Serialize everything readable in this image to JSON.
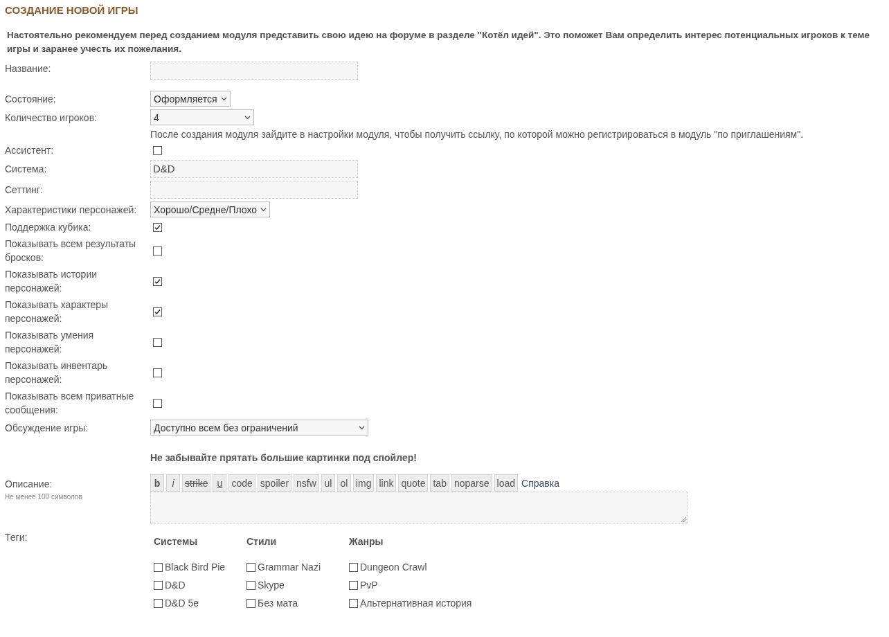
{
  "title": "СОЗДАНИЕ НОВОЙ ИГРЫ",
  "intro": "Настоятельно рекомендуем перед созданием модуля представить свою идею на форуме в разделе \"Котёл идей\". Это поможет Вам определить интерес потенциальных игроков к теме игры и заранее учесть их пожелания.",
  "fields": [
    {
      "kind": "text",
      "label": "Название:"
    },
    {
      "kind": "select",
      "label": "Состояние:",
      "value": "Оформляется"
    },
    {
      "kind": "select",
      "label": "Количество игроков:",
      "value": "4",
      "note": "После создания модуля зайдите в настройки модуля, чтобы получить ссылку, по которой можно регистрироваться в модуль \"по приглашениям\"."
    },
    {
      "kind": "checkbox",
      "label": "Ассистент:",
      "checked": false
    },
    {
      "kind": "text",
      "label": "Система:",
      "value": "D&D"
    },
    {
      "kind": "text",
      "label": "Сеттинг:"
    },
    {
      "kind": "select",
      "label": "Характеристики персонажей:",
      "value": "Хорошо/Средне/Плохо"
    },
    {
      "kind": "checkbox",
      "label": "Поддержка кубика:",
      "checked": true
    },
    {
      "kind": "checkbox",
      "label": "Показывать всем результаты бросков:",
      "checked": false
    },
    {
      "kind": "checkbox",
      "label": "Показывать истории персонажей:",
      "checked": true
    },
    {
      "kind": "checkbox",
      "label": "Показывать характеры персонажей:",
      "checked": true
    },
    {
      "kind": "checkbox",
      "label": "Показывать умения персонажей:",
      "checked": false
    },
    {
      "kind": "checkbox",
      "label": "Показывать инвентарь персонажей:",
      "checked": false
    },
    {
      "kind": "checkbox",
      "label": "Показывать всем приватные сообщения:",
      "checked": false
    },
    {
      "kind": "select",
      "label": "Обсуждение игры:",
      "value": "Доступно всем без ограничений"
    }
  ],
  "spoiler_notice": "Не забывайте прятать большие картинки под спойлер!",
  "description": {
    "label": "Описание:",
    "hint": "Не менее 100 символов",
    "help_link": "Справка",
    "toolbar": [
      {
        "label": "b",
        "kind": "bold"
      },
      {
        "label": "i",
        "kind": "italic"
      },
      {
        "label": "strike",
        "kind": "strike"
      },
      {
        "label": "u",
        "kind": "underline"
      },
      {
        "label": "code",
        "kind": "plain"
      },
      {
        "label": "spoiler",
        "kind": "plain"
      },
      {
        "label": "nsfw",
        "kind": "plain"
      },
      {
        "label": "ul",
        "kind": "plain"
      },
      {
        "label": "ol",
        "kind": "plain"
      },
      {
        "label": "img",
        "kind": "plain"
      },
      {
        "label": "link",
        "kind": "plain"
      },
      {
        "label": "quote",
        "kind": "plain"
      },
      {
        "label": "tab",
        "kind": "plain"
      },
      {
        "label": "noparse",
        "kind": "plain"
      },
      {
        "label": "load",
        "kind": "plain"
      }
    ]
  },
  "tags": {
    "label": "Теги:",
    "groups": [
      {
        "title": "Системы",
        "items": [
          {
            "label": "Black Bird Pie",
            "checked": false
          },
          {
            "label": "D&D",
            "checked": false
          },
          {
            "label": "D&D 5e",
            "checked": false
          }
        ]
      },
      {
        "title": "Стили",
        "items": [
          {
            "label": "Grammar Nazi",
            "checked": false
          },
          {
            "label": "Skype",
            "checked": false
          },
          {
            "label": "Без мата",
            "checked": false
          }
        ]
      },
      {
        "title": "Жанры",
        "items": [
          {
            "label": "Dungeon Crawl",
            "checked": false
          },
          {
            "label": "PvP",
            "checked": false
          },
          {
            "label": "Альтернативная история",
            "checked": false
          }
        ]
      }
    ]
  }
}
